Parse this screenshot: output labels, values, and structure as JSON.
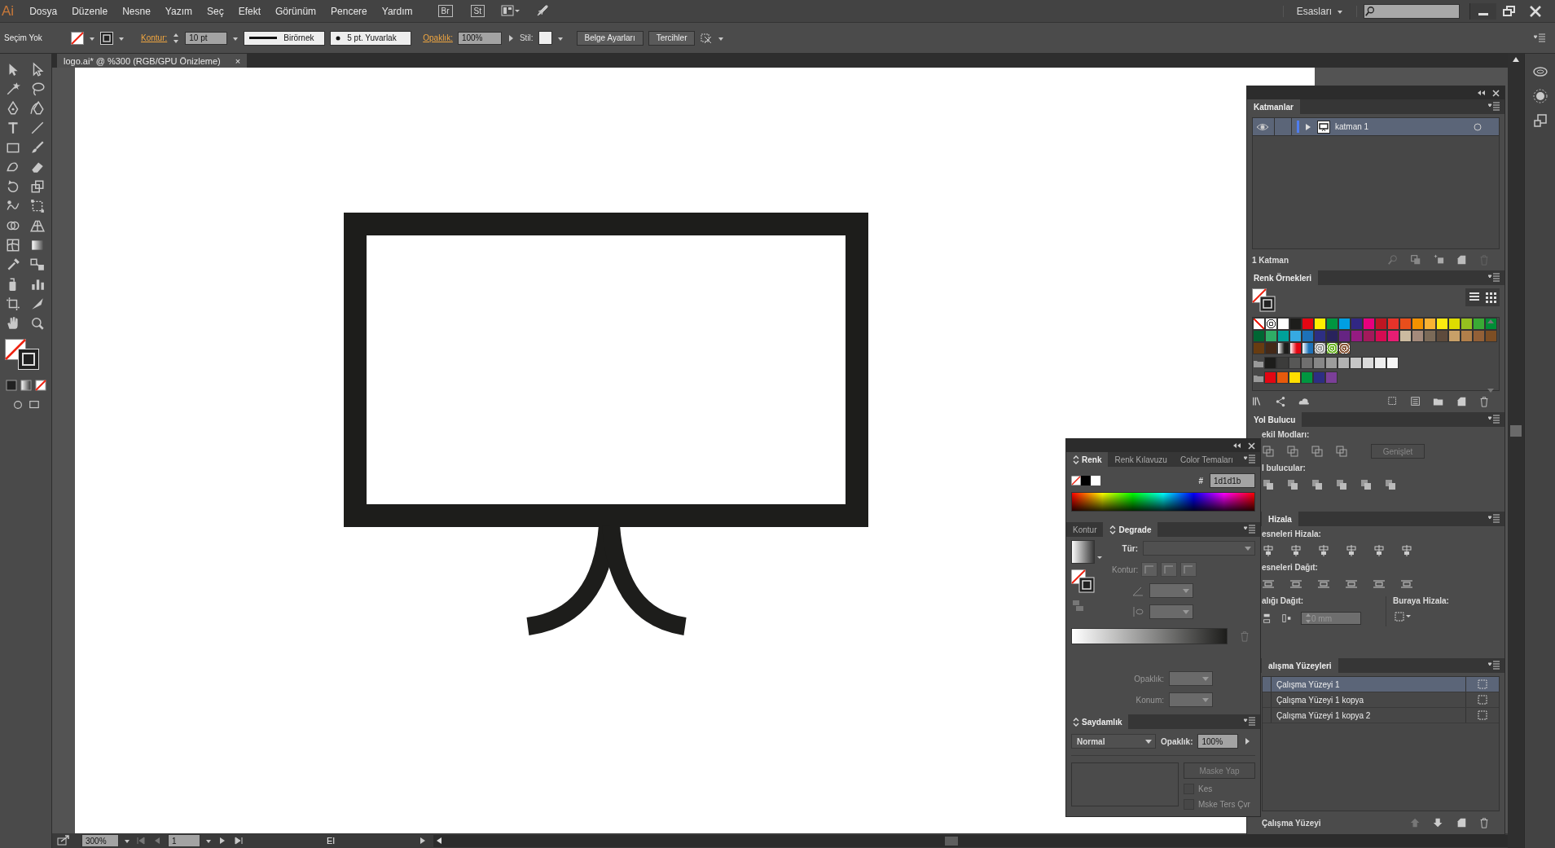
{
  "app": {
    "logo": "Ai",
    "menus": [
      "Dosya",
      "Düzenle",
      "Nesne",
      "Yazım",
      "Seç",
      "Efekt",
      "Görünüm",
      "Pencere",
      "Yardım"
    ],
    "bridge": "Br",
    "stock": "St",
    "workspace": "Esasları"
  },
  "control_bar": {
    "selection": "Seçim Yok",
    "stroke_label": "Kontur:",
    "stroke_weight": "10 pt",
    "profile": "Birörnek",
    "brush": "5 pt. Yuvarlak",
    "opacity_label": "Opaklık:",
    "opacity": "100%",
    "style_label": "Stil:",
    "buttons": [
      "Belge Ayarları",
      "Tercihler"
    ]
  },
  "document_tab": {
    "title": "logo.ai* @ %300 (RGB/GPU Önizleme)",
    "close": "×"
  },
  "layers_panel": {
    "title": "Katmanlar",
    "layers": [
      {
        "name": "katman 1",
        "visible": true,
        "selected": true,
        "expanded": false,
        "color": "#4f7df0"
      }
    ],
    "count": "1 Katman"
  },
  "swatches_panel": {
    "title": "Renk Örnekleri",
    "rows": [
      {
        "folder": false,
        "swatches": [
          {
            "kind": "none"
          },
          {
            "kind": "registration"
          },
          {
            "kind": "solid",
            "color": "#ffffff"
          },
          {
            "kind": "solid",
            "color": "#1d1d1b"
          },
          {
            "kind": "solid",
            "color": "#e30613"
          },
          {
            "kind": "solid",
            "color": "#ffed00"
          },
          {
            "kind": "solid",
            "color": "#009640"
          },
          {
            "kind": "solid",
            "color": "#009fe3"
          },
          {
            "kind": "solid",
            "color": "#312783"
          },
          {
            "kind": "solid",
            "color": "#e6007e"
          },
          {
            "kind": "solid",
            "color": "#be1622"
          },
          {
            "kind": "solid",
            "color": "#e6332a"
          },
          {
            "kind": "solid",
            "color": "#e94e1b"
          },
          {
            "kind": "solid",
            "color": "#f39200"
          },
          {
            "kind": "solid",
            "color": "#f9b233"
          },
          {
            "kind": "solid",
            "color": "#fcea10"
          },
          {
            "kind": "solid",
            "color": "#dedc00"
          },
          {
            "kind": "solid",
            "color": "#95c11f"
          },
          {
            "kind": "solid",
            "color": "#3aaa35"
          },
          {
            "kind": "solid",
            "color": "#008d36"
          }
        ]
      },
      {
        "folder": false,
        "swatches": [
          {
            "kind": "solid",
            "color": "#006633"
          },
          {
            "kind": "solid",
            "color": "#2fac66"
          },
          {
            "kind": "solid",
            "color": "#00a19a"
          },
          {
            "kind": "solid",
            "color": "#36a9e1"
          },
          {
            "kind": "solid",
            "color": "#1d71b8"
          },
          {
            "kind": "solid",
            "color": "#2d2e83"
          },
          {
            "kind": "solid",
            "color": "#29235c"
          },
          {
            "kind": "solid",
            "color": "#662483"
          },
          {
            "kind": "solid",
            "color": "#951b81"
          },
          {
            "kind": "solid",
            "color": "#a3195b"
          },
          {
            "kind": "solid",
            "color": "#d60b52"
          },
          {
            "kind": "solid",
            "color": "#e71d73"
          },
          {
            "kind": "solid",
            "color": "#cbbba0"
          },
          {
            "kind": "solid",
            "color": "#a48a7b"
          },
          {
            "kind": "solid",
            "color": "#7b6a58"
          },
          {
            "kind": "solid",
            "color": "#5e4b3c"
          },
          {
            "kind": "solid",
            "color": "#c8a068"
          },
          {
            "kind": "solid",
            "color": "#b17f4a"
          },
          {
            "kind": "solid",
            "color": "#936037"
          },
          {
            "kind": "solid",
            "color": "#7d4e24"
          }
        ]
      },
      {
        "folder": false,
        "swatches": [
          {
            "kind": "solid",
            "color": "#683c11"
          },
          {
            "kind": "solid",
            "color": "#432918"
          },
          {
            "kind": "gradient",
            "color": "#1d1d1b"
          },
          {
            "kind": "gradient",
            "color": "#e30613"
          },
          {
            "kind": "gradient",
            "color": "#1d71b8"
          },
          {
            "kind": "pattern",
            "color": "#9a9a9a"
          },
          {
            "kind": "pattern",
            "color": "#6fb52c"
          },
          {
            "kind": "pattern",
            "color": "#8a5a3c"
          }
        ]
      },
      {
        "folder": true,
        "swatches": [
          {
            "kind": "solid",
            "color": "#1d1d1b"
          },
          {
            "kind": "solid",
            "color": "#3c3c3b"
          },
          {
            "kind": "solid",
            "color": "#575756"
          },
          {
            "kind": "solid",
            "color": "#706f6f"
          },
          {
            "kind": "solid",
            "color": "#878787"
          },
          {
            "kind": "solid",
            "color": "#9d9d9c"
          },
          {
            "kind": "solid",
            "color": "#b2b2b2"
          },
          {
            "kind": "solid",
            "color": "#c6c6c6"
          },
          {
            "kind": "solid",
            "color": "#dadada"
          },
          {
            "kind": "solid",
            "color": "#ededed"
          },
          {
            "kind": "solid",
            "color": "#f6f6f6"
          }
        ]
      },
      {
        "folder": true,
        "swatches": [
          {
            "kind": "solid",
            "color": "#e30613"
          },
          {
            "kind": "solid",
            "color": "#e85a0c"
          },
          {
            "kind": "solid",
            "color": "#ffde00"
          },
          {
            "kind": "solid",
            "color": "#009640"
          },
          {
            "kind": "solid",
            "color": "#2d2e83"
          },
          {
            "kind": "solid",
            "color": "#7b3f98"
          }
        ]
      }
    ]
  },
  "pathfinder_panel": {
    "title": "Yol Bulucu",
    "shape_modes_label": "ekil Modları:",
    "expand": "Genişlet",
    "pathfinders_label": "l bulucular:"
  },
  "align_panel": {
    "title": "Hizala",
    "align_objects_label": "esneleri Hizala:",
    "distribute_objects_label": "esneleri Dağıt:",
    "distribute_spacing_label": "alığı Dağıt:",
    "spacing": "0 mm",
    "align_to_label": "Buraya Hizala:"
  },
  "artboards_panel": {
    "title": "alışma Yüzeyleri",
    "artboards": [
      {
        "name": "Çalışma Yüzeyi 1",
        "selected": true
      },
      {
        "name": "Çalışma Yüzeyi 1 kopya",
        "selected": false
      },
      {
        "name": "Çalışma Yüzeyi 1 kopya 2",
        "selected": false
      }
    ],
    "count": "Çalışma Yüzeyi"
  },
  "color_panel": {
    "tabs": [
      {
        "label": "Renk",
        "selected": true
      },
      {
        "label": "Renk Kılavuzu",
        "selected": false
      },
      {
        "label": "Color Temaları",
        "selected": false
      }
    ],
    "hex_label": "#",
    "hex": "1d1d1b"
  },
  "gradient_panel": {
    "tabs": [
      {
        "label": "Kontur",
        "selected": false
      },
      {
        "label": "Degrade",
        "selected": true
      }
    ],
    "type_label": "Tür:",
    "stroke_label": "Kontur:",
    "opacity_label": "Opaklık:",
    "location_label": "Konum:"
  },
  "transparency_panel": {
    "title": "Saydamlık",
    "blend_mode": "Normal",
    "opacity_label": "Opaklık:",
    "opacity": "100%",
    "make_mask": "Maske Yap",
    "options": [
      {
        "label": "Kes",
        "checked": false
      },
      {
        "label": "Mske Ters Çvr",
        "checked": false
      }
    ]
  },
  "status_bar": {
    "zoom": "300%",
    "artboard": "1",
    "tool": "El"
  }
}
